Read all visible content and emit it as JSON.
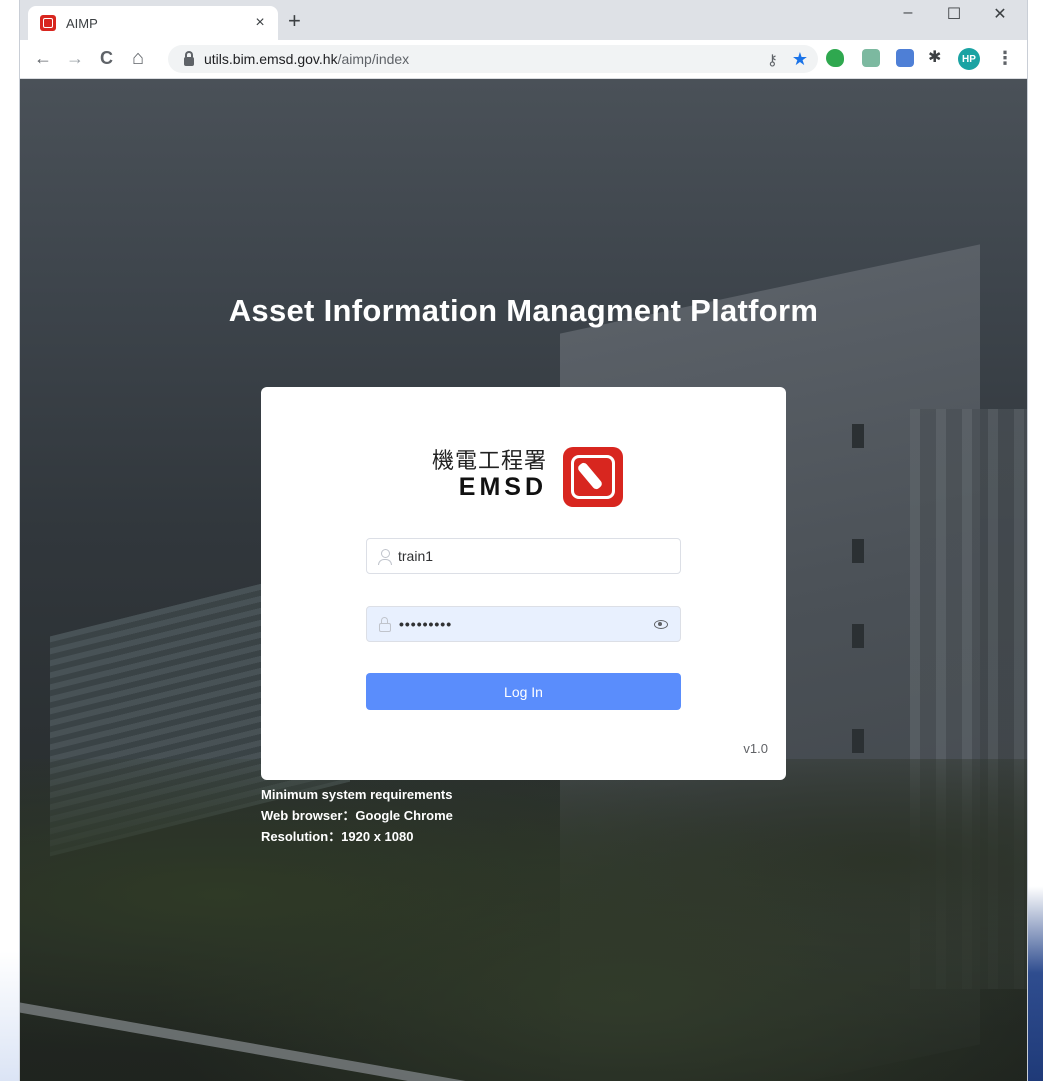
{
  "browser": {
    "tab": {
      "title": "AIMP",
      "close": "×"
    },
    "new_tab": "+",
    "window_controls": {
      "minimize": "–",
      "maximize": "☐",
      "close": "✕"
    },
    "nav": {
      "back": "←",
      "forward": "→",
      "reload": "C",
      "home": "⌂"
    },
    "url": {
      "host": "utils.bim.emsd.gov.hk",
      "path": "/aimp/index"
    },
    "profile_initials": "HP",
    "menu": "⋮"
  },
  "page": {
    "title": "Asset Information Managment Platform",
    "logo": {
      "chinese": "機電工程署",
      "english": "EMSD"
    },
    "username": {
      "value": "train1"
    },
    "password": {
      "value": "•••••••••"
    },
    "login_button": "Log In",
    "version": "v1.0",
    "requirements": [
      "Minimum system requirements",
      "Web browser：Google Chrome",
      "Resolution：1920 x 1080"
    ]
  },
  "colors": {
    "accent": "#5a8dfc",
    "brand_red": "#d8261f",
    "password_fill": "#e8f0fe"
  }
}
